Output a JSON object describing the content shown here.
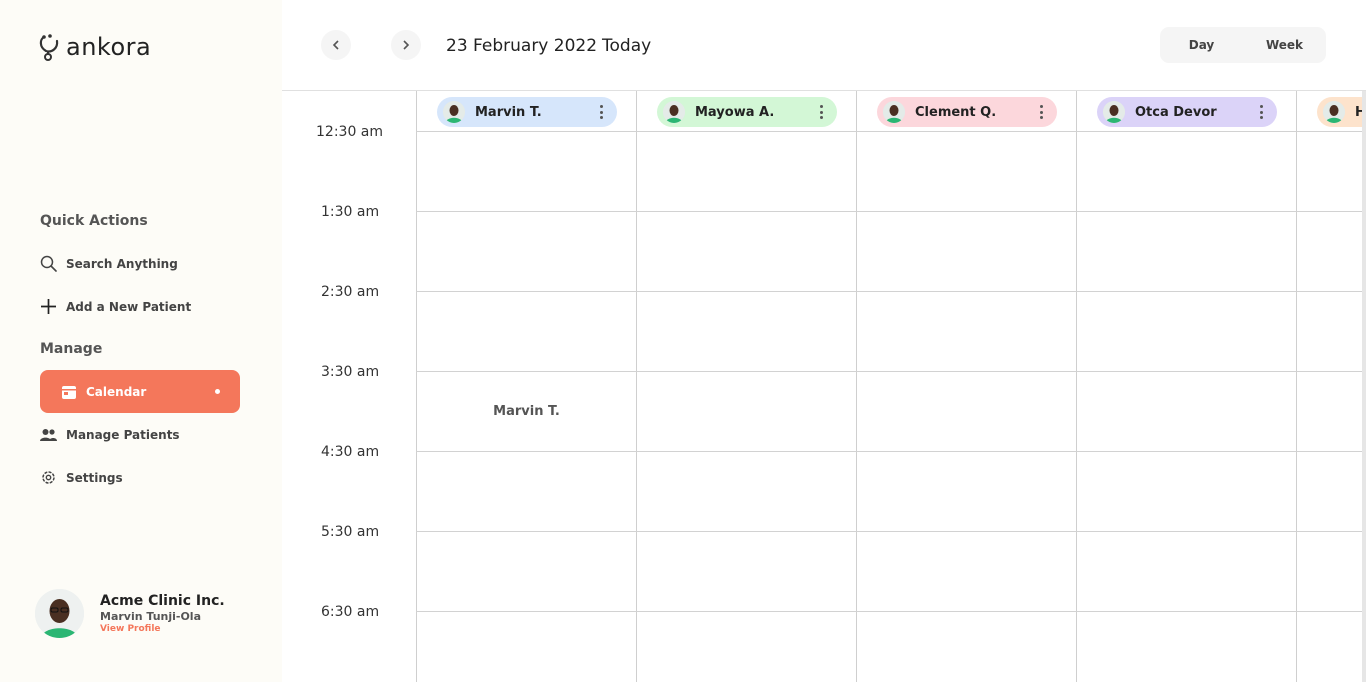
{
  "app": {
    "logo_text": "ankora"
  },
  "sidebar": {
    "quick_actions_title": "Quick Actions",
    "quick_actions": [
      {
        "label": "Search Anything",
        "icon": "search-icon"
      },
      {
        "label": "Add a New Patient",
        "icon": "plus-icon"
      }
    ],
    "manage_title": "Manage",
    "manage_items": [
      {
        "label": "Calendar",
        "icon": "calendar-icon",
        "active": true
      },
      {
        "label": "Manage Patients",
        "icon": "users-icon",
        "active": false
      },
      {
        "label": "Settings",
        "icon": "gear-icon",
        "active": false
      }
    ]
  },
  "profile": {
    "clinic": "Acme Clinic Inc.",
    "user": "Marvin Tunji-Ola",
    "link": "View Profile"
  },
  "header": {
    "date": "23 February 2022",
    "today": "Today",
    "prev_icon": "chevron-left-icon",
    "next_icon": "chevron-right-icon",
    "views": [
      "Day",
      "Week"
    ]
  },
  "colors": {
    "accent": "#f4775b",
    "pill_colors": [
      "#d6e6fb",
      "#d3f7d6",
      "#fcd7dc",
      "#dbd3f8",
      "#fde3cc"
    ]
  },
  "calendar": {
    "times": [
      "12:30 am",
      "1:30 am",
      "2:30 am",
      "3:30 am",
      "4:30 am",
      "5:30 am",
      "6:30 am"
    ],
    "doctors": [
      "Marvin T.",
      "Mayowa A.",
      "Clement Q.",
      "Otca Devor",
      "H"
    ],
    "events": [
      {
        "label": "Marvin T.",
        "doctor": "Marvin T.",
        "time": "3:30 am"
      }
    ]
  }
}
